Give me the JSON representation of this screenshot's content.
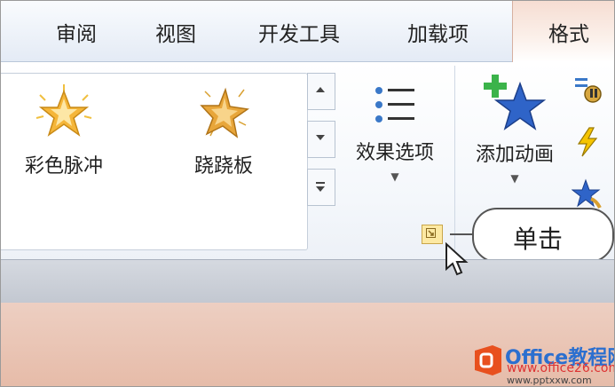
{
  "tabs": [
    {
      "label": "审阅"
    },
    {
      "label": "视图"
    },
    {
      "label": "开发工具"
    },
    {
      "label": "加载项"
    },
    {
      "label": "格式"
    }
  ],
  "gallery": {
    "items": [
      {
        "label": "彩色脉冲",
        "icon": "star-burst-icon"
      },
      {
        "label": "跷跷板",
        "icon": "star-seesaw-icon"
      }
    ]
  },
  "effect_options": {
    "label": "效果选项"
  },
  "add_animation": {
    "label": "添加动画"
  },
  "callout": {
    "text": "单击"
  },
  "watermark": {
    "brand": "Office教程网",
    "url": "www.office26.com",
    "url2": "www.pptxxw.com"
  },
  "colors": {
    "active_tab": "#f6ddd2",
    "launcher": "#fde9a3",
    "canvas": "#e9c6b6"
  }
}
